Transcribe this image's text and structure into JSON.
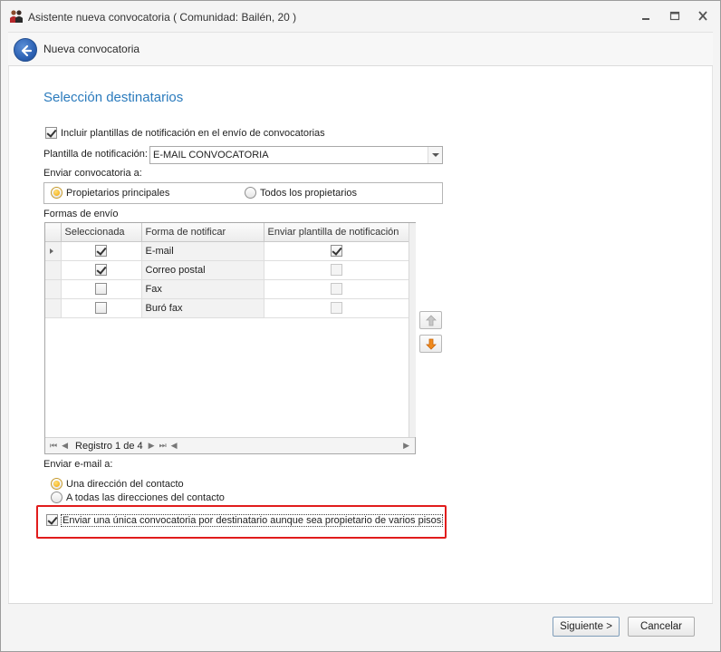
{
  "window": {
    "title": "Asistente nueva convocatoria ( Comunidad: Bailén, 20 )"
  },
  "header": {
    "title": "Nueva convocatoria"
  },
  "section": {
    "title": "Selección destinatarios"
  },
  "include_templates": {
    "label": "Incluir plantillas de notificación en el envío de convocatorias",
    "checked": true
  },
  "template": {
    "label": "Plantilla de notificación:",
    "value": "E-MAIL CONVOCATORIA"
  },
  "send_to": {
    "label": "Enviar convocatoria a:",
    "options": [
      "Propietarios principales",
      "Todos los propietarios"
    ],
    "selected": "Propietarios principales"
  },
  "delivery": {
    "label": "Formas de envío",
    "columns": [
      "Seleccionada",
      "Forma de notificar",
      "Enviar plantilla de notificación"
    ],
    "rows": [
      {
        "selected": true,
        "method": "E-mail",
        "send_template": true,
        "template_enabled": true
      },
      {
        "selected": true,
        "method": "Correo postal",
        "send_template": false,
        "template_enabled": false
      },
      {
        "selected": false,
        "method": "Fax",
        "send_template": false,
        "template_enabled": false
      },
      {
        "selected": false,
        "method": "Buró fax",
        "send_template": false,
        "template_enabled": false
      }
    ],
    "navigator": "Registro 1 de 4"
  },
  "email_to": {
    "label": "Enviar e-mail a:",
    "options": [
      "Una dirección del contacto",
      "A todas las direcciones del contacto"
    ],
    "selected": "Una dirección del contacto"
  },
  "single_notice": {
    "label": "Enviar una única convocatoria por destinatario aunque sea propietario de varios pisos",
    "checked": true
  },
  "footer": {
    "next_label": "Siguiente >",
    "cancel_label": "Cancelar"
  },
  "colors": {
    "section_title": "#2b7bbd",
    "highlight": "#e11c1c",
    "radio_selected": "#f2a400"
  }
}
